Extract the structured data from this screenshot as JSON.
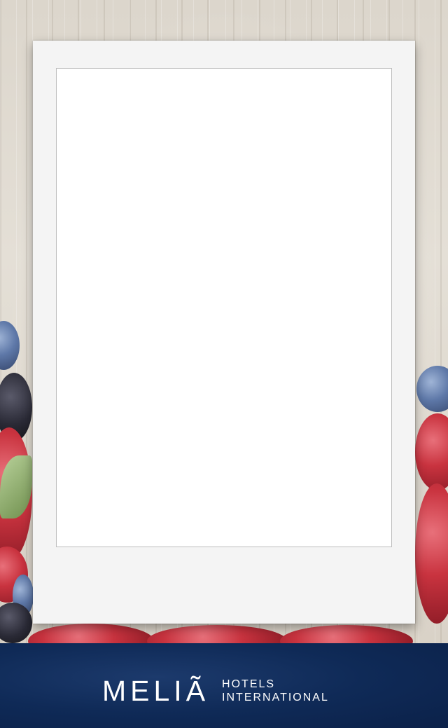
{
  "brand": {
    "name": "MELIÃ",
    "tagline_line1": "HOTELS",
    "tagline_line2": "INTERNATIONAL"
  },
  "colors": {
    "footer_background": "#0f2a57",
    "frame": "#f4f4f4",
    "photo": "#ffffff"
  },
  "icons": [
    "blueberry-decoration",
    "strawberry-decoration",
    "blackberry-decoration"
  ]
}
